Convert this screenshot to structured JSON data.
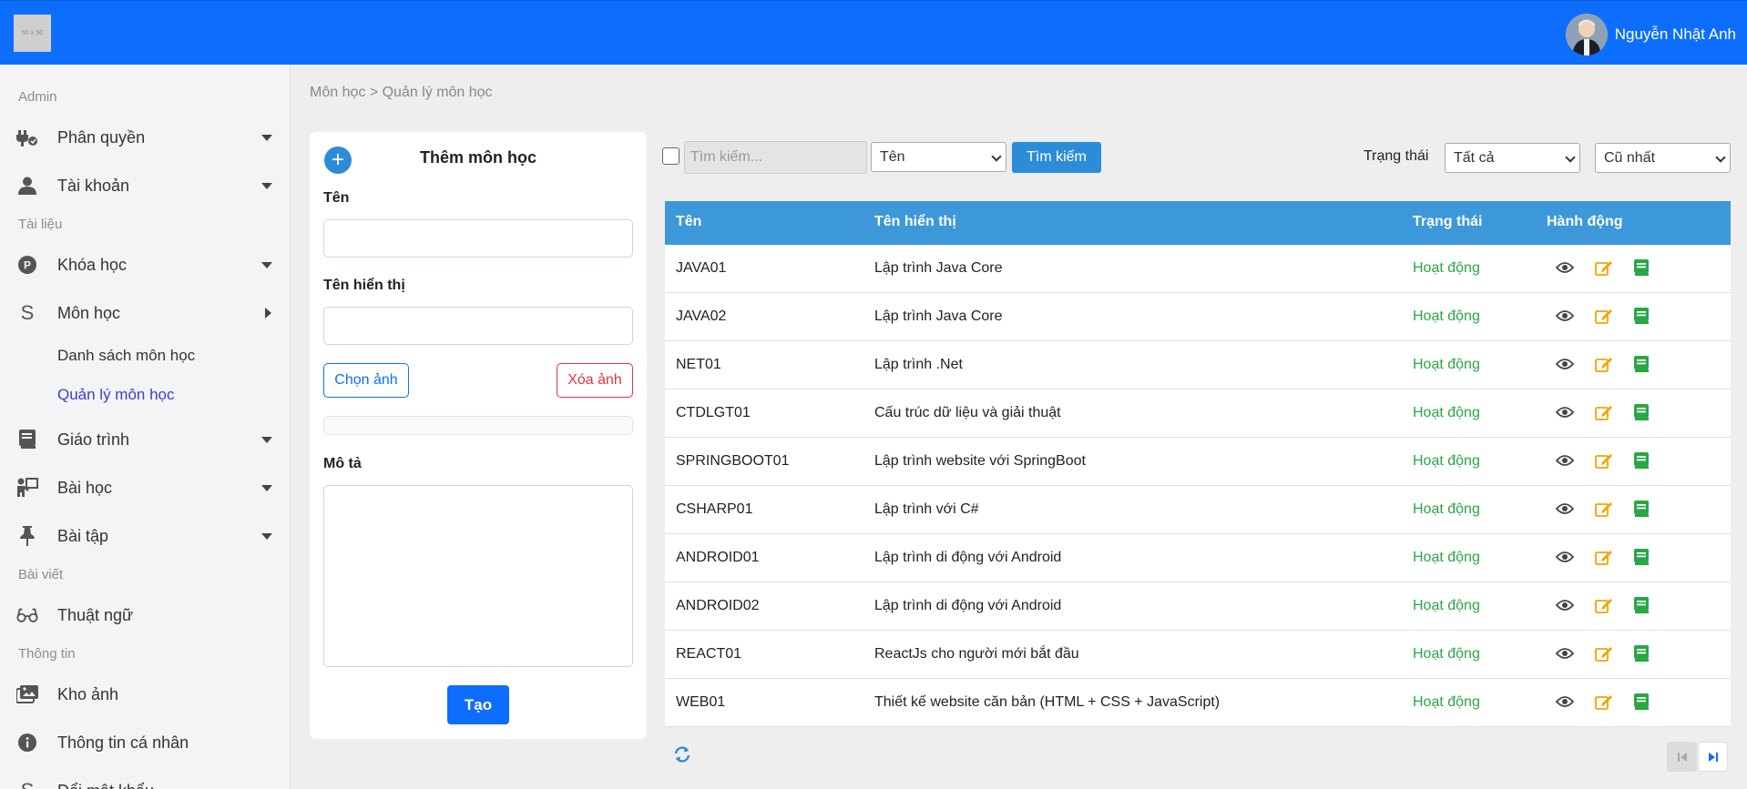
{
  "header": {
    "logo_text": "50 x 50",
    "user_name": "Nguyễn Nhật Anh",
    "brand_color": "#0d6efd"
  },
  "sidebar": {
    "sections": {
      "admin": "Admin",
      "documents": "Tài liệu",
      "posts": "Bài viết",
      "info": "Thông tin"
    },
    "items": [
      {
        "label": "Phân quyền",
        "icon": "plug-icon"
      },
      {
        "label": "Tài khoản",
        "icon": "user-icon"
      },
      {
        "label": "Khóa học",
        "icon": "p-circle-icon"
      },
      {
        "label": "Môn học",
        "icon": "s-letter-icon"
      },
      {
        "label": "Giáo trình",
        "icon": "book-icon"
      },
      {
        "label": "Bài học",
        "icon": "teacher-icon"
      },
      {
        "label": "Bài tập",
        "icon": "pin-icon"
      },
      {
        "label": "Thuật ngữ",
        "icon": "glasses-icon"
      },
      {
        "label": "Kho ảnh",
        "icon": "images-icon"
      },
      {
        "label": "Thông tin cá nhân",
        "icon": "info-icon"
      },
      {
        "label": "Đổi mật khẩu",
        "icon": "key-icon"
      }
    ],
    "subitems": {
      "list": "Danh sách môn học",
      "manage": "Quản lý môn học"
    }
  },
  "breadcrumb": "Môn học > Quản lý môn học",
  "form": {
    "title": "Thêm môn học",
    "name_label": "Tên",
    "name_value": "",
    "display_label": "Tên hiển thị",
    "display_value": "",
    "choose_image": "Chọn ảnh",
    "delete_image": "Xóa ảnh",
    "description_label": "Mô tả",
    "create_button": "Tạo"
  },
  "toolbar": {
    "search_placeholder": "Tìm kiếm...",
    "field_select": "Tên",
    "search_button": "Tìm kiếm",
    "status_label": "Trạng thái",
    "status_select": "Tất cả",
    "sort_select": "Cũ nhất"
  },
  "table": {
    "columns": [
      "Tên",
      "Tên hiển thị",
      "Trạng thái",
      "Hành động"
    ],
    "rows": [
      {
        "name": "JAVA01",
        "display": "Lập trình Java Core",
        "status": "Hoạt động"
      },
      {
        "name": "JAVA02",
        "display": "Lập trình Java Core",
        "status": "Hoạt động"
      },
      {
        "name": "NET01",
        "display": "Lập trình .Net",
        "status": "Hoạt động"
      },
      {
        "name": "CTDLGT01",
        "display": "Cấu trúc dữ liệu và giải thuật",
        "status": "Hoạt động"
      },
      {
        "name": "SPRINGBOOT01",
        "display": "Lập trình website với SpringBoot",
        "status": "Hoạt động"
      },
      {
        "name": "CSHARP01",
        "display": "Lập trình với C#",
        "status": "Hoạt động"
      },
      {
        "name": "ANDROID01",
        "display": "Lập trình di động với Android",
        "status": "Hoạt động"
      },
      {
        "name": "ANDROID02",
        "display": "Lập trình di động với Android",
        "status": "Hoạt động"
      },
      {
        "name": "REACT01",
        "display": "ReactJs cho người mới bắt đầu",
        "status": "Hoạt động"
      },
      {
        "name": "WEB01",
        "display": "Thiết kế website căn bản (HTML + CSS + JavaScript)",
        "status": "Hoạt động"
      }
    ],
    "header_color": "#3d98d9",
    "status_color": "#28a745"
  }
}
